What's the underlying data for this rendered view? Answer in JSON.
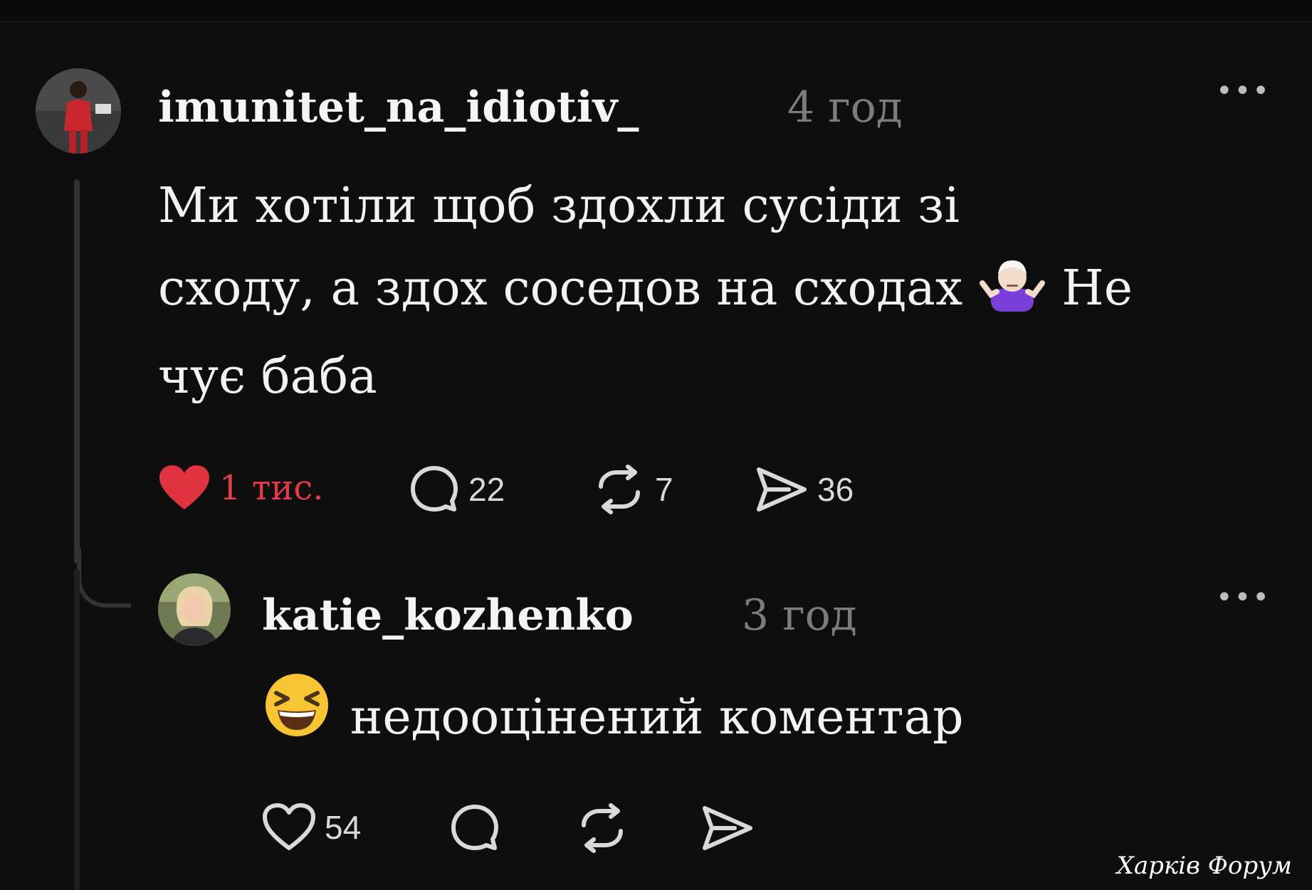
{
  "comment": {
    "username": "imunitet_na_idiotiv_",
    "time": "4 год",
    "more_label": "•••",
    "text_line1": "Ми хотіли щоб здохли сусіди зі",
    "text_line2a": "сходу, а здох соседов на сходах",
    "text_line2b": "Не",
    "text_line3": "чує баба",
    "emoji_icon": "person-shrugging-emoji",
    "likes": "1 тис.",
    "comments": "22",
    "reposts": "7",
    "shares": "36",
    "liked": true,
    "like_color": "#e33b47"
  },
  "reply": {
    "username": "katie_kozhenko",
    "time": "3 год",
    "more_label": "•••",
    "emoji_icon": "laughing-squinting-face-emoji",
    "text": "недооцінений коментар",
    "likes": "54",
    "liked": false
  },
  "watermark": "Харків Форум"
}
